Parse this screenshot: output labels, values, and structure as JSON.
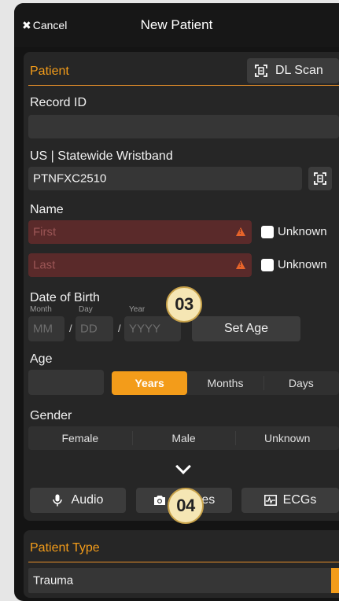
{
  "header": {
    "cancel_label": "Cancel",
    "title": "New Patient"
  },
  "patient": {
    "section_title": "Patient",
    "dl_scan_label": "DL Scan",
    "record_id": {
      "label": "Record ID",
      "value": ""
    },
    "wristband": {
      "label": "US | Statewide Wristband",
      "value": "PTNFXC2510"
    },
    "name": {
      "label": "Name",
      "first_placeholder": "First",
      "last_placeholder": "Last",
      "unknown_label": "Unknown"
    },
    "dob": {
      "label": "Date of Birth",
      "month_label": "Month",
      "day_label": "Day",
      "year_label": "Year",
      "month_placeholder": "MM",
      "day_placeholder": "DD",
      "year_placeholder": "YYYY",
      "separator": "/",
      "set_age_label": "Set Age"
    },
    "age": {
      "label": "Age",
      "units": [
        "Years",
        "Months",
        "Days"
      ],
      "selected": "Years"
    },
    "gender": {
      "label": "Gender",
      "options": [
        "Female",
        "Male",
        "Unknown"
      ]
    },
    "attachments": {
      "audio": "Audio",
      "images": "Images",
      "ecgs": "ECGs"
    }
  },
  "patient_type": {
    "section_title": "Patient Type",
    "value": "Trauma"
  },
  "badges": {
    "b03": "03",
    "b04": "04"
  },
  "colors": {
    "accent": "#f39c1a",
    "error_bg": "#5a2a2a",
    "background": "#141414"
  }
}
